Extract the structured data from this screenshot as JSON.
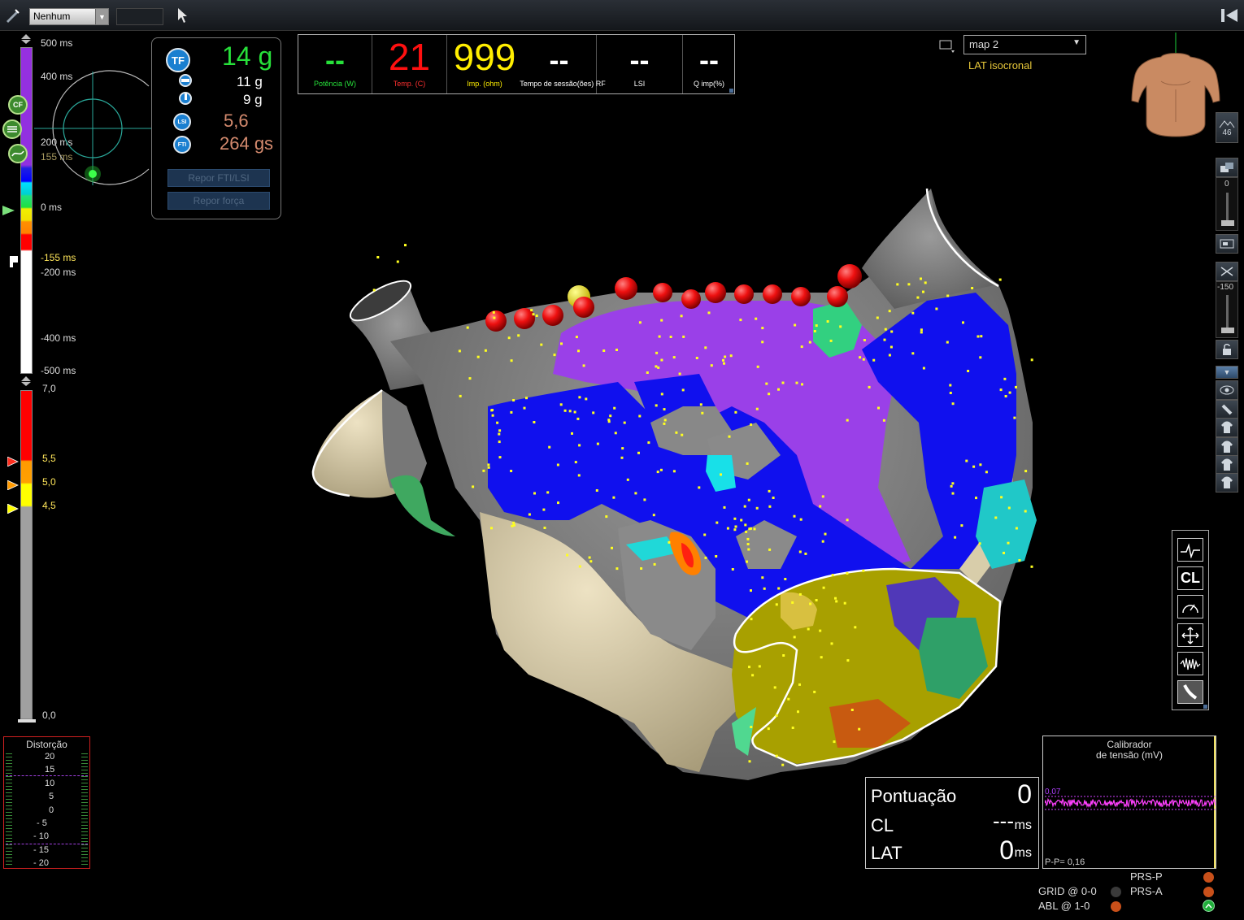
{
  "toolbar": {
    "mode_dropdown": "Nenhum",
    "secondary_dropdown": ""
  },
  "lat_scale": {
    "top": "500 ms",
    "tick_400": "400 ms",
    "tick_200": "200 ms",
    "marker_155": "155 ms",
    "zero": "0 ms",
    "neg_155": "-155 ms",
    "neg_200": "-200 ms",
    "neg_400": "-400 ms",
    "neg_500": "-500 ms"
  },
  "voltage_scale": {
    "top": "7,0",
    "v55": "5,5",
    "v50": "5,0",
    "v45": "4,5",
    "bottom": "0,0"
  },
  "side_badges": {
    "cf": "CF"
  },
  "force_panel": {
    "tf_label": "TF",
    "tf_value": "14 g",
    "axial_value": "11 g",
    "lateral_value": "9 g",
    "lsi_label": "LSI",
    "lsi_value": "5,6",
    "fti_label": "FTI",
    "fti_value": "264 gs",
    "reset_fti_button": "Repor FTI/LSI",
    "reset_force_button": "Repor força"
  },
  "ablation": {
    "power_value": "--",
    "power_label": "Potência (W)",
    "temp_value": "21",
    "temp_label": "Temp. (C)",
    "imp_value": "999",
    "imp_label": "Imp. (ohm)",
    "session_value": "--",
    "session_label": "Tempo de sessão(ões) RF",
    "lsi_value": "--",
    "lsi_label": "LSI",
    "qimp_value": "--",
    "qimp_label": "Q imp(%)"
  },
  "map": {
    "selected": "map 2",
    "type": "LAT isocronal"
  },
  "right_toolbar": {
    "threshold_value": "46",
    "slider_value": "0",
    "clip_value": "-150"
  },
  "score": {
    "score_label": "Pontuação",
    "score_value": "0",
    "cl_label": "CL",
    "cl_value": "---",
    "cl_unit": "ms",
    "lat_label": "LAT",
    "lat_value": "0",
    "lat_unit": "ms"
  },
  "calibrator": {
    "title_line1": "Calibrador",
    "title_line2": "de tensão (mV)",
    "trace_value": "0,07",
    "pp_value": "P-P= 0,16"
  },
  "distortion": {
    "title": "Distorção",
    "ticks": [
      "20",
      "15",
      "10",
      "5",
      "0",
      "- 5",
      "- 10",
      "- 15",
      "- 20"
    ]
  },
  "status": {
    "grid": "GRID @ 0-0",
    "abl": "ABL @ 1-0",
    "prs_p": "PRS-P",
    "prs_a": "PRS-A"
  },
  "colors": {
    "accent_green": "#27e03a",
    "temp_red": "#ff1010",
    "imp_yellow": "#ffee00",
    "map_label_yellow": "#e8c83a"
  }
}
